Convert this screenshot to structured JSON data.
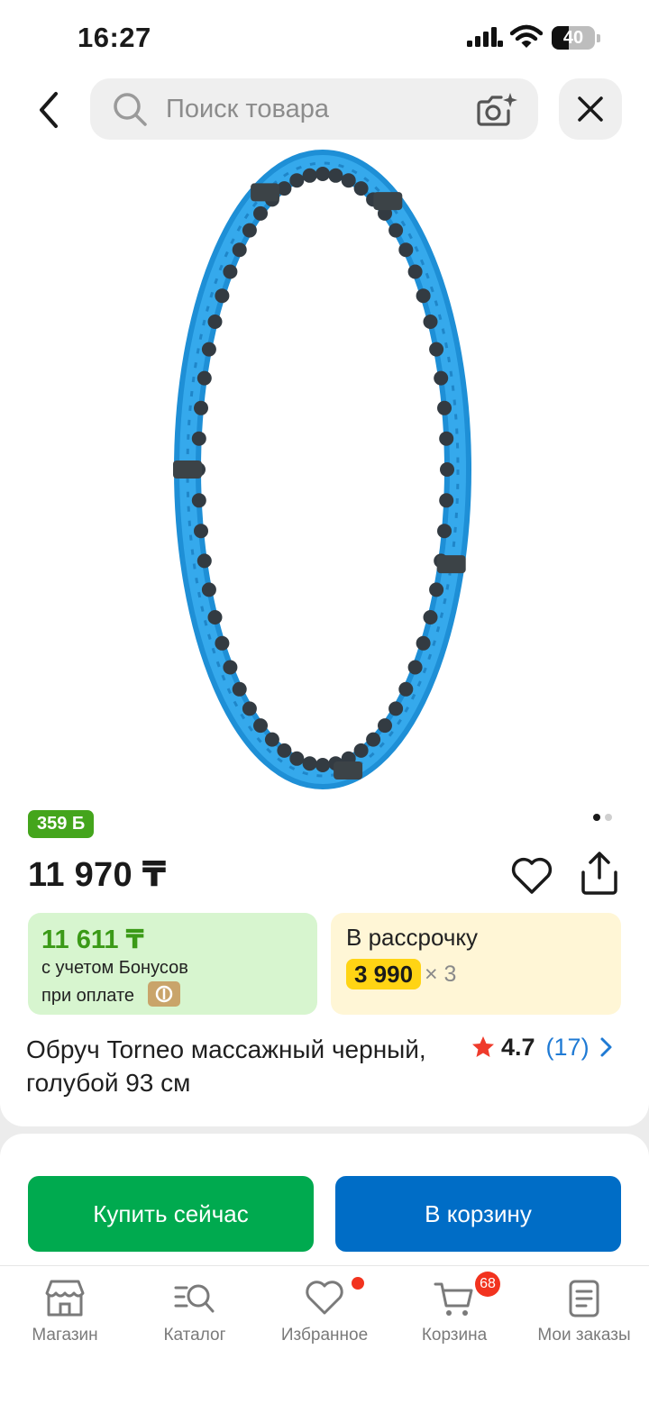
{
  "status_bar": {
    "time": "16:27",
    "battery_level": "40",
    "battery_fraction": 0.4,
    "icons": [
      "signal-icon",
      "wifi-icon",
      "battery-icon"
    ]
  },
  "header": {
    "search_placeholder": "Поиск товара",
    "icons": [
      "back-arrow-icon",
      "search-icon",
      "camera-icon",
      "close-icon"
    ]
  },
  "gallery": {
    "image_count": 2,
    "active_index": 0,
    "image_subject": "blue massage hula hoop"
  },
  "product": {
    "bonus_badge": "359 Б",
    "price": "11 970 ₸",
    "bonus_price": "11 611 ₸",
    "bonus_line1": "с учетом Бонусов",
    "bonus_line2": "при оплате",
    "installment_title": "В рассрочку",
    "installment_amount": "3 990",
    "installment_times": "× 3",
    "title": "Обруч Torneo массажный черный, голубой 93 см",
    "rating": "4.7",
    "reviews": "(17)"
  },
  "actions": {
    "buy_now": "Купить сейчас",
    "add_to_cart": "В корзину"
  },
  "bottom_nav": {
    "items": [
      {
        "label": "Магазин",
        "icon": "store-icon"
      },
      {
        "label": "Каталог",
        "icon": "catalog-search-icon"
      },
      {
        "label": "Избранное",
        "icon": "heart-icon"
      },
      {
        "label": "Корзина",
        "icon": "cart-icon"
      },
      {
        "label": "Мои заказы",
        "icon": "orders-icon"
      }
    ],
    "cart_count": "68"
  },
  "colors": {
    "accent_green": "#00aa4f",
    "accent_blue": "#006dc6",
    "bonus_green": "#44a51c",
    "installment_yellow": "#ffd414",
    "badge_red": "#f2331f",
    "link_blue": "#1f7ad4"
  }
}
